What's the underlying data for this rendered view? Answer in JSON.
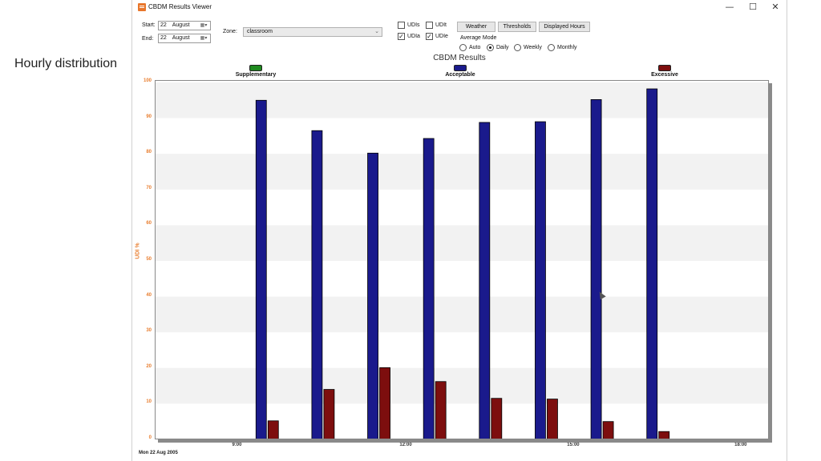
{
  "slide": {
    "caption": "Hourly distribution"
  },
  "window": {
    "title": "CBDM Results Viewer",
    "controls": {
      "minimize": "—",
      "maximize": "☐",
      "close": "✕"
    }
  },
  "toolbar": {
    "start_label": "Start:",
    "start_day": "22",
    "start_month": "August",
    "end_label": "End:",
    "end_day": "22",
    "end_month": "August",
    "zone_label": "Zone:",
    "zone_value": "classroom",
    "checkboxes": [
      {
        "label": "UDIs",
        "checked": false
      },
      {
        "label": "UDIt",
        "checked": false
      },
      {
        "label": "UDIa",
        "checked": true
      },
      {
        "label": "UDIe",
        "checked": true
      }
    ],
    "buttons": {
      "weather": "Weather",
      "thresholds": "Thresholds",
      "displayed_hours": "Displayed Hours"
    },
    "average_mode_label": "Average Mode",
    "average_modes": [
      {
        "label": "Auto",
        "selected": false
      },
      {
        "label": "Daily",
        "selected": true
      },
      {
        "label": "Weekly",
        "selected": false
      },
      {
        "label": "Monthly",
        "selected": false
      }
    ]
  },
  "colors": {
    "acceptable": "#1a1a8c",
    "excessive": "#7d0e0e",
    "supplementary": "#1f8a1f",
    "axis_text": "#e87d2e"
  },
  "chart_data": {
    "type": "bar",
    "title": "CBDM Results",
    "ylabel": "UDI %",
    "xlabel": "",
    "ylim": [
      0,
      100
    ],
    "yticks": [
      "0",
      "10",
      "20",
      "30",
      "40",
      "50",
      "60",
      "70",
      "80",
      "90",
      "100"
    ],
    "xlim": [
      7.5,
      18.5
    ],
    "xticks": [
      {
        "label": "9:00",
        "value": 9
      },
      {
        "label": "12:00",
        "value": 12
      },
      {
        "label": "15:00",
        "value": 15
      },
      {
        "label": "18:00",
        "value": 18
      }
    ],
    "x": [
      9.5,
      10.5,
      11.5,
      12.5,
      13.5,
      14.5,
      15.5,
      16.5
    ],
    "legend_placement": "top",
    "series": [
      {
        "name": "Supplementary",
        "values": [
          0,
          0,
          0,
          0,
          0,
          0,
          0,
          0
        ]
      },
      {
        "name": "Acceptable",
        "values": [
          95,
          86.5,
          80.2,
          84.3,
          88.8,
          89,
          95.2,
          98.2
        ]
      },
      {
        "name": "Excessive",
        "values": [
          5.2,
          14,
          20.1,
          16.2,
          11.5,
          11.3,
          5,
          2.2
        ]
      }
    ],
    "footer_date": "Mon 22 Aug 2005"
  }
}
